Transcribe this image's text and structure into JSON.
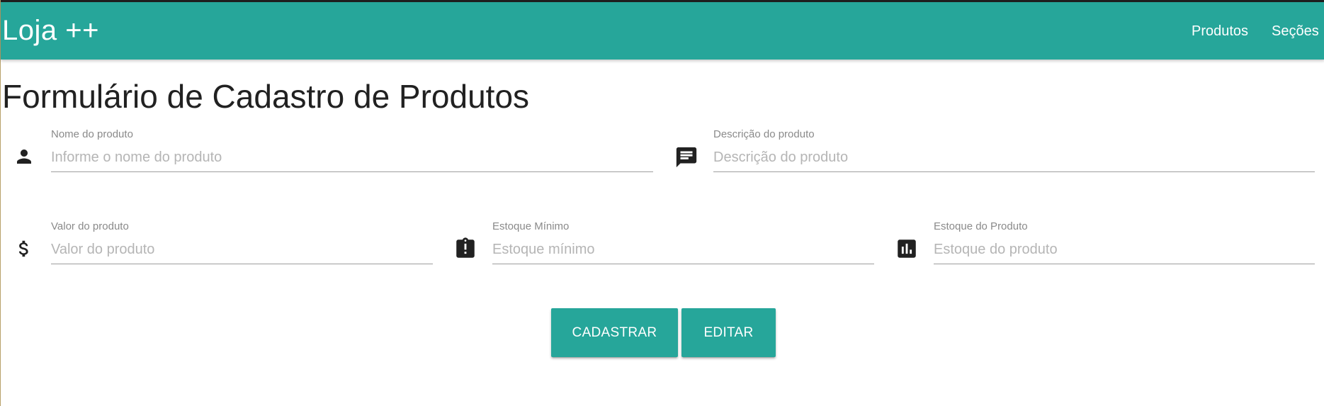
{
  "navbar": {
    "brand": "Loja ++",
    "links": [
      {
        "label": "Produtos"
      },
      {
        "label": "Seções"
      }
    ],
    "color": "#26a69a"
  },
  "page": {
    "title": "Formulário de Cadastro de Produtos"
  },
  "form": {
    "nome": {
      "label": "Nome do produto",
      "placeholder": "Informe o nome do produto",
      "value": "",
      "icon": "person-icon"
    },
    "descricao": {
      "label": "Descrição do produto",
      "placeholder": "Descrição do produto",
      "value": "",
      "icon": "chat-message-icon"
    },
    "valor": {
      "label": "Valor do produto",
      "placeholder": "Valor do produto",
      "value": "",
      "icon": "dollar-icon"
    },
    "estoque_minimo": {
      "label": "Estoque Mínimo",
      "placeholder": "Estoque mínimo",
      "value": "",
      "icon": "clipboard-alert-icon"
    },
    "estoque": {
      "label": "Estoque do Produto",
      "placeholder": "Estoque do produto",
      "value": "",
      "icon": "bar-chart-icon"
    }
  },
  "buttons": {
    "cadastrar": "CADASTRAR",
    "editar": "EDITAR"
  }
}
